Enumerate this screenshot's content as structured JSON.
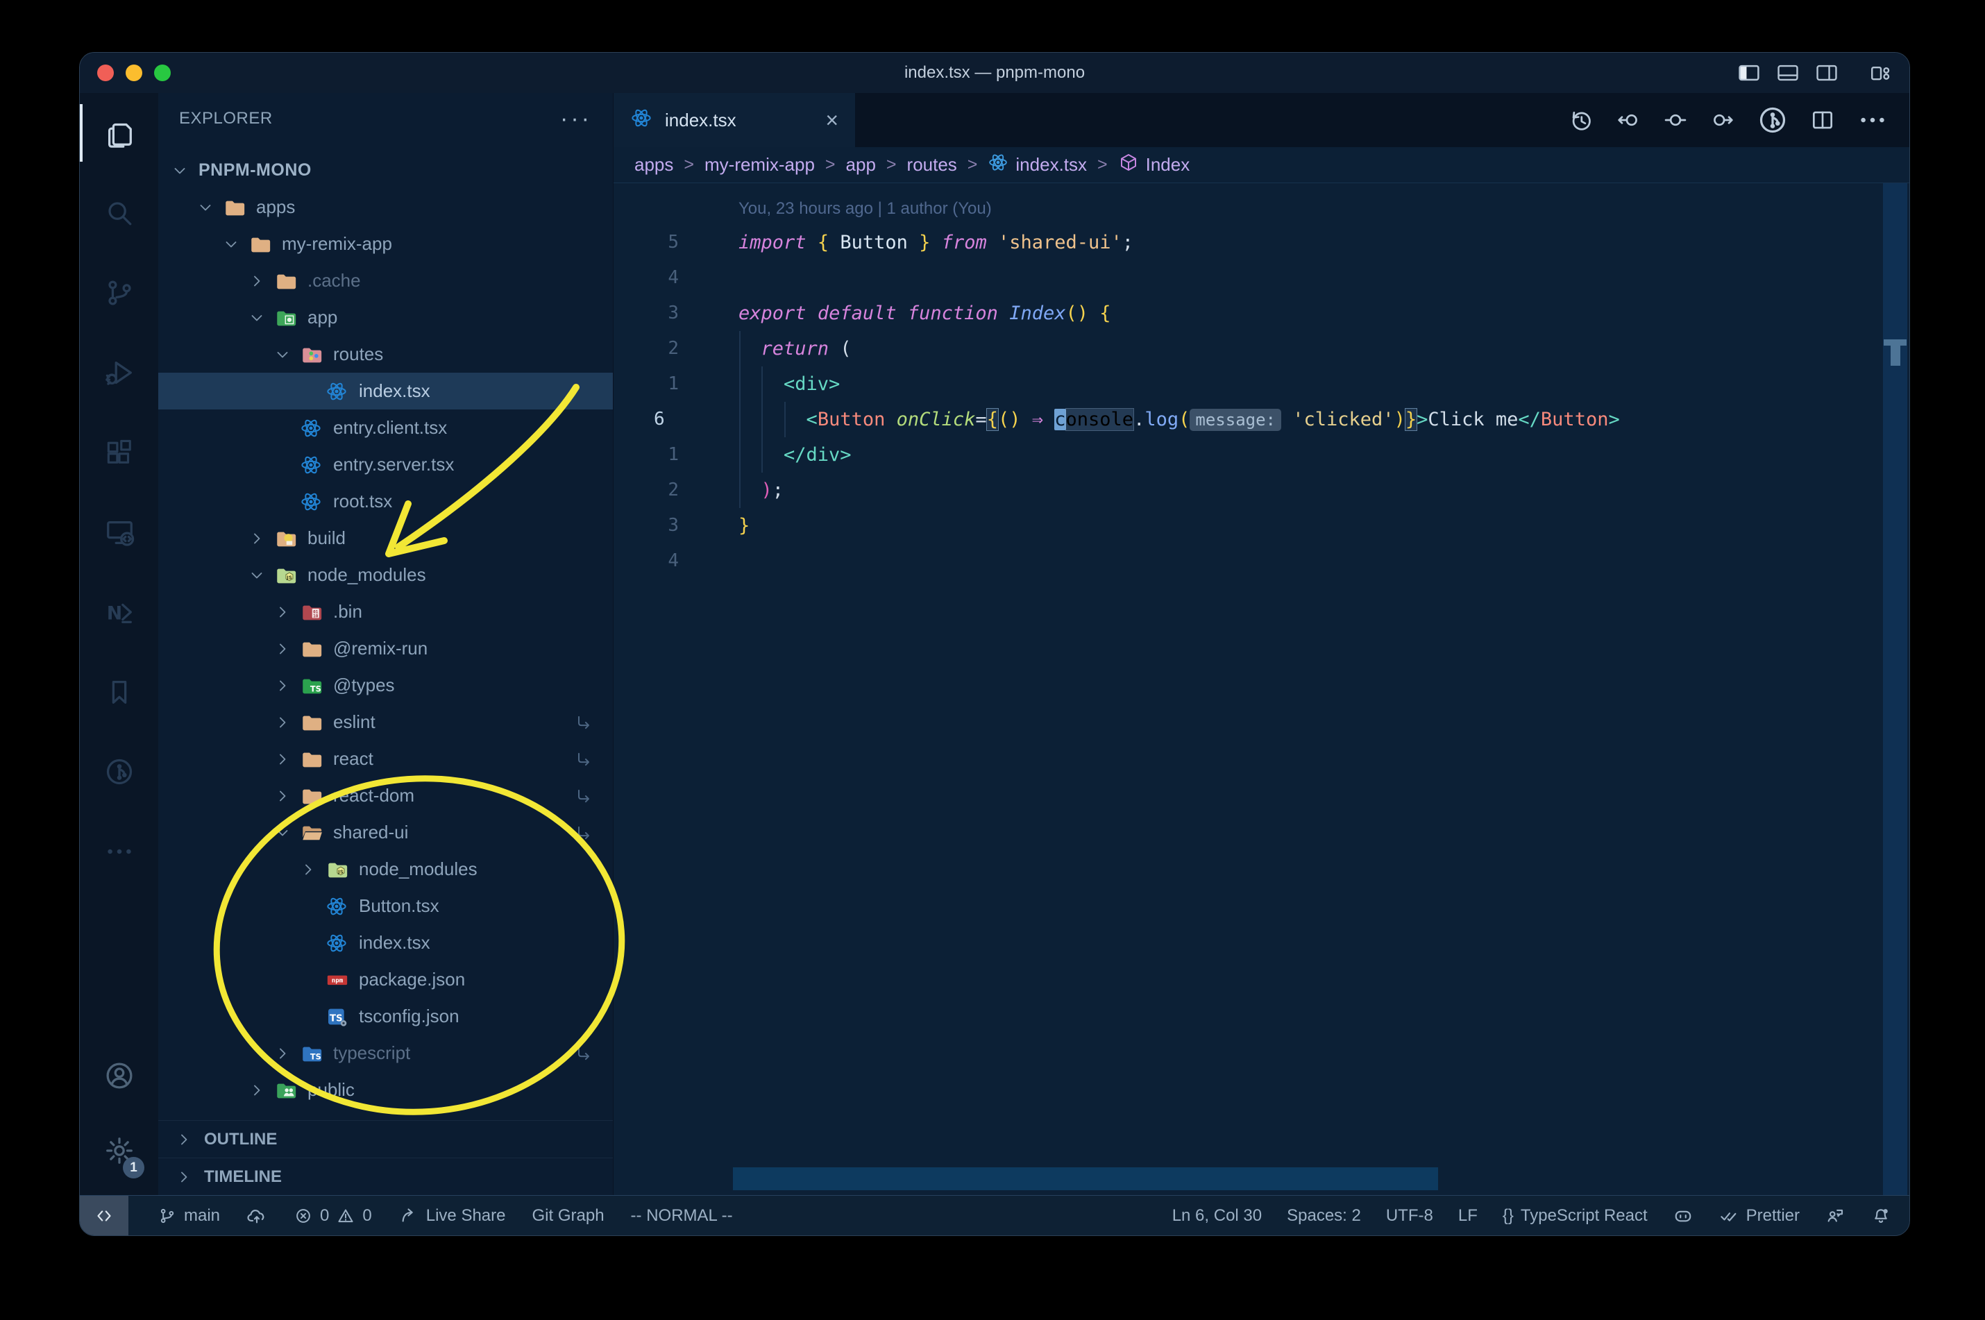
{
  "window": {
    "title": "index.tsx — pnpm-mono"
  },
  "colors": {
    "annotation_yellow": "#f2e735",
    "selection_bg": "#1e3a58",
    "editor_bg": "#0c2036",
    "accent_blue": "#2285d6"
  },
  "title_controls": [
    {
      "name": "toggle-sidebar-icon",
      "icon": "layout-left"
    },
    {
      "name": "toggle-panel-icon",
      "icon": "layout-panel"
    },
    {
      "name": "toggle-secondary-sidebar-icon",
      "icon": "layout-right"
    },
    {
      "name": "separator",
      "icon": "sep"
    },
    {
      "name": "customize-layout-icon",
      "icon": "layout-custom"
    }
  ],
  "activity_bar": {
    "top": [
      {
        "name": "explorer",
        "icon": "files",
        "active": true
      },
      {
        "name": "search",
        "icon": "search"
      },
      {
        "name": "source-control",
        "icon": "source-control"
      },
      {
        "name": "run-and-debug",
        "icon": "debug"
      },
      {
        "name": "extensions",
        "icon": "extensions"
      },
      {
        "name": "remote-explorer",
        "icon": "remote-explorer"
      },
      {
        "name": "nx-console",
        "icon": "nx"
      },
      {
        "name": "bookmarks",
        "icon": "bookmark"
      },
      {
        "name": "git-graph",
        "icon": "git-graph-circle"
      },
      {
        "name": "more-views",
        "icon": "more"
      }
    ],
    "bottom": [
      {
        "name": "account",
        "icon": "account"
      },
      {
        "name": "settings",
        "icon": "gear",
        "badge": "1"
      }
    ]
  },
  "sidebar": {
    "header": "EXPLORER",
    "more_label": "···",
    "tree": [
      {
        "label": "PNPM-MONO",
        "depth": 0,
        "chevron": "down",
        "icon": null,
        "root": true
      },
      {
        "label": "apps",
        "depth": 1,
        "chevron": "down",
        "icon": "folder-tan"
      },
      {
        "label": "my-remix-app",
        "depth": 2,
        "chevron": "down",
        "icon": "folder-tan"
      },
      {
        "label": ".cache",
        "depth": 3,
        "chevron": "right",
        "icon": "folder-tan",
        "dimmed": true
      },
      {
        "label": "app",
        "depth": 3,
        "chevron": "down",
        "icon": "folder-app"
      },
      {
        "label": "routes",
        "depth": 4,
        "chevron": "down",
        "icon": "folder-routes"
      },
      {
        "label": "index.tsx",
        "depth": 5,
        "chevron": null,
        "icon": "react",
        "selected": true
      },
      {
        "label": "entry.client.tsx",
        "depth": 4,
        "chevron": null,
        "icon": "react"
      },
      {
        "label": "entry.server.tsx",
        "depth": 4,
        "chevron": null,
        "icon": "react"
      },
      {
        "label": "root.tsx",
        "depth": 4,
        "chevron": null,
        "icon": "react"
      },
      {
        "label": "build",
        "depth": 3,
        "chevron": "right",
        "icon": "folder-build"
      },
      {
        "label": "node_modules",
        "depth": 3,
        "chevron": "down",
        "icon": "folder-nm"
      },
      {
        "label": ".bin",
        "depth": 4,
        "chevron": "right",
        "icon": "folder-bin"
      },
      {
        "label": "@remix-run",
        "depth": 4,
        "chevron": "right",
        "icon": "folder-tan"
      },
      {
        "label": "@types",
        "depth": 4,
        "chevron": "right",
        "icon": "folder-types"
      },
      {
        "label": "eslint",
        "depth": 4,
        "chevron": "right",
        "icon": "folder-tan",
        "symlink": true
      },
      {
        "label": "react",
        "depth": 4,
        "chevron": "right",
        "icon": "folder-tan",
        "symlink": true
      },
      {
        "label": "react-dom",
        "depth": 4,
        "chevron": "right",
        "icon": "folder-tan",
        "symlink": true
      },
      {
        "label": "shared-ui",
        "depth": 4,
        "chevron": "down",
        "icon": "folder-tan-open",
        "symlink": true
      },
      {
        "label": "node_modules",
        "depth": 5,
        "chevron": "right",
        "icon": "folder-nm"
      },
      {
        "label": "Button.tsx",
        "depth": 5,
        "chevron": null,
        "icon": "react"
      },
      {
        "label": "index.tsx",
        "depth": 5,
        "chevron": null,
        "icon": "react"
      },
      {
        "label": "package.json",
        "depth": 5,
        "chevron": null,
        "icon": "npm"
      },
      {
        "label": "tsconfig.json",
        "depth": 5,
        "chevron": null,
        "icon": "tsconfig"
      },
      {
        "label": "typescript",
        "depth": 4,
        "chevron": "right",
        "icon": "folder-ts",
        "dimmed": true,
        "symlink": true
      },
      {
        "label": "public",
        "depth": 3,
        "chevron": "right",
        "icon": "folder-public"
      }
    ],
    "sections": [
      "OUTLINE",
      "TIMELINE"
    ]
  },
  "tab": {
    "label": "index.tsx",
    "close": "×"
  },
  "editor_actions": [
    {
      "name": "timeline-history",
      "icon": "history"
    },
    {
      "name": "gitlens-back",
      "icon": "gl-back"
    },
    {
      "name": "gitlens-current",
      "icon": "gl-current"
    },
    {
      "name": "gitlens-forward",
      "icon": "gl-forward"
    },
    {
      "name": "git-graph",
      "icon": "git-graph-circle"
    },
    {
      "name": "split-editor",
      "icon": "split"
    },
    {
      "name": "more-actions",
      "icon": "more"
    }
  ],
  "breadcrumbs": [
    {
      "label": "apps"
    },
    {
      "label": "my-remix-app"
    },
    {
      "label": "app"
    },
    {
      "label": "routes"
    },
    {
      "label": "index.tsx",
      "icon": "react-small"
    },
    {
      "label": "Index",
      "icon": "symbol-module"
    }
  ],
  "editor": {
    "blame": "You, 23 hours ago | 1 author (You)",
    "lines": [
      {
        "num": "5",
        "tokens": [
          [
            "kw",
            "import"
          ],
          [
            "pl",
            " "
          ],
          [
            "yb",
            "{"
          ],
          [
            "pl",
            " "
          ],
          [
            "var",
            "Button"
          ],
          [
            "pl",
            " "
          ],
          [
            "yb",
            "}"
          ],
          [
            "pl",
            " "
          ],
          [
            "kw",
            "from"
          ],
          [
            "pl",
            " "
          ],
          [
            "str",
            "'shared-ui'"
          ],
          [
            "pun",
            ";"
          ]
        ]
      },
      {
        "num": "4",
        "tokens": []
      },
      {
        "num": "3",
        "tokens": [
          [
            "kw",
            "export"
          ],
          [
            "pl",
            " "
          ],
          [
            "kw",
            "default"
          ],
          [
            "pl",
            " "
          ],
          [
            "kw",
            "function"
          ],
          [
            "pl",
            " "
          ],
          [
            "cls",
            "Index"
          ],
          [
            "yb",
            "()"
          ],
          [
            "pl",
            " "
          ],
          [
            "yb",
            "{"
          ]
        ]
      },
      {
        "num": "2",
        "tokens": [
          [
            "pl",
            "  "
          ],
          [
            "kw",
            "return"
          ],
          [
            "pl",
            " "
          ],
          [
            "pun",
            "("
          ]
        ]
      },
      {
        "num": "1",
        "tokens": [
          [
            "pl",
            "    "
          ],
          [
            "tag",
            "<div>"
          ]
        ]
      },
      {
        "num": "6",
        "current": true,
        "tokens": [
          [
            "pl",
            "      "
          ],
          [
            "tag",
            "<"
          ],
          [
            "comp",
            "Button"
          ],
          [
            "pl",
            " "
          ],
          [
            "attr",
            "onClick"
          ],
          [
            "pun",
            "="
          ],
          [
            "ybx",
            "{"
          ],
          [
            "yb",
            "()"
          ],
          [
            "pl",
            " "
          ],
          [
            "kw",
            "⇒"
          ],
          [
            "pl",
            " "
          ],
          [
            "cur",
            "c"
          ],
          [
            "hl",
            "onsole"
          ],
          [
            "pun",
            "."
          ],
          [
            "fn",
            "log"
          ],
          [
            "yb",
            "("
          ],
          [
            "inlay",
            "message:"
          ],
          [
            "pl",
            " "
          ],
          [
            "str2",
            "'clicked'"
          ],
          [
            "yb",
            ")"
          ],
          [
            "ybx",
            "}"
          ],
          [
            "tag",
            ">"
          ],
          [
            "pun",
            "Click me"
          ],
          [
            "tag",
            "</"
          ],
          [
            "comp",
            "Button"
          ],
          [
            "tag",
            ">"
          ]
        ]
      },
      {
        "num": "1",
        "tokens": [
          [
            "pl",
            "    "
          ],
          [
            "tag",
            "</div>"
          ]
        ]
      },
      {
        "num": "2",
        "tokens": [
          [
            "pl",
            "  "
          ],
          [
            "pk",
            ")"
          ],
          [
            "pun",
            ";"
          ]
        ]
      },
      {
        "num": "3",
        "tokens": [
          [
            "yb",
            "}"
          ]
        ]
      },
      {
        "num": "4",
        "tokens": []
      }
    ]
  },
  "status_bar": {
    "left": [
      {
        "name": "remote-indicator",
        "remote": true,
        "parts": [
          {
            "icon": "remote"
          }
        ]
      },
      {
        "name": "git-branch",
        "parts": [
          {
            "icon": "branch"
          },
          {
            "text": "main"
          }
        ]
      },
      {
        "name": "sync-changes",
        "parts": [
          {
            "icon": "cloud-upload"
          }
        ]
      },
      {
        "name": "problems",
        "parts": [
          {
            "icon": "error"
          },
          {
            "text": "0"
          },
          {
            "icon": "warning"
          },
          {
            "text": "0"
          }
        ]
      },
      {
        "name": "live-share",
        "parts": [
          {
            "icon": "live-share"
          },
          {
            "text": "Live Share"
          }
        ]
      },
      {
        "name": "git-graph",
        "parts": [
          {
            "text": "Git Graph"
          }
        ]
      },
      {
        "name": "vim-mode",
        "parts": [
          {
            "text": "-- NORMAL --"
          }
        ]
      }
    ],
    "right": [
      {
        "name": "cursor-position",
        "parts": [
          {
            "text": "Ln 6, Col 30"
          }
        ]
      },
      {
        "name": "indentation",
        "parts": [
          {
            "text": "Spaces: 2"
          }
        ]
      },
      {
        "name": "encoding",
        "parts": [
          {
            "text": "UTF-8"
          }
        ]
      },
      {
        "name": "eol",
        "parts": [
          {
            "text": "LF"
          }
        ]
      },
      {
        "name": "language-mode",
        "parts": [
          {
            "text": "{}"
          },
          {
            "text": "TypeScript React"
          }
        ]
      },
      {
        "name": "copilot",
        "parts": [
          {
            "icon": "copilot"
          }
        ]
      },
      {
        "name": "prettier",
        "parts": [
          {
            "icon": "double-check"
          },
          {
            "text": "Prettier"
          }
        ]
      },
      {
        "name": "feedback",
        "parts": [
          {
            "icon": "person-feedback"
          }
        ]
      },
      {
        "name": "notifications",
        "parts": [
          {
            "icon": "bell-dot"
          }
        ]
      }
    ]
  },
  "traffic_lights": [
    "#f05f57",
    "#fbbd2e",
    "#28c841"
  ]
}
